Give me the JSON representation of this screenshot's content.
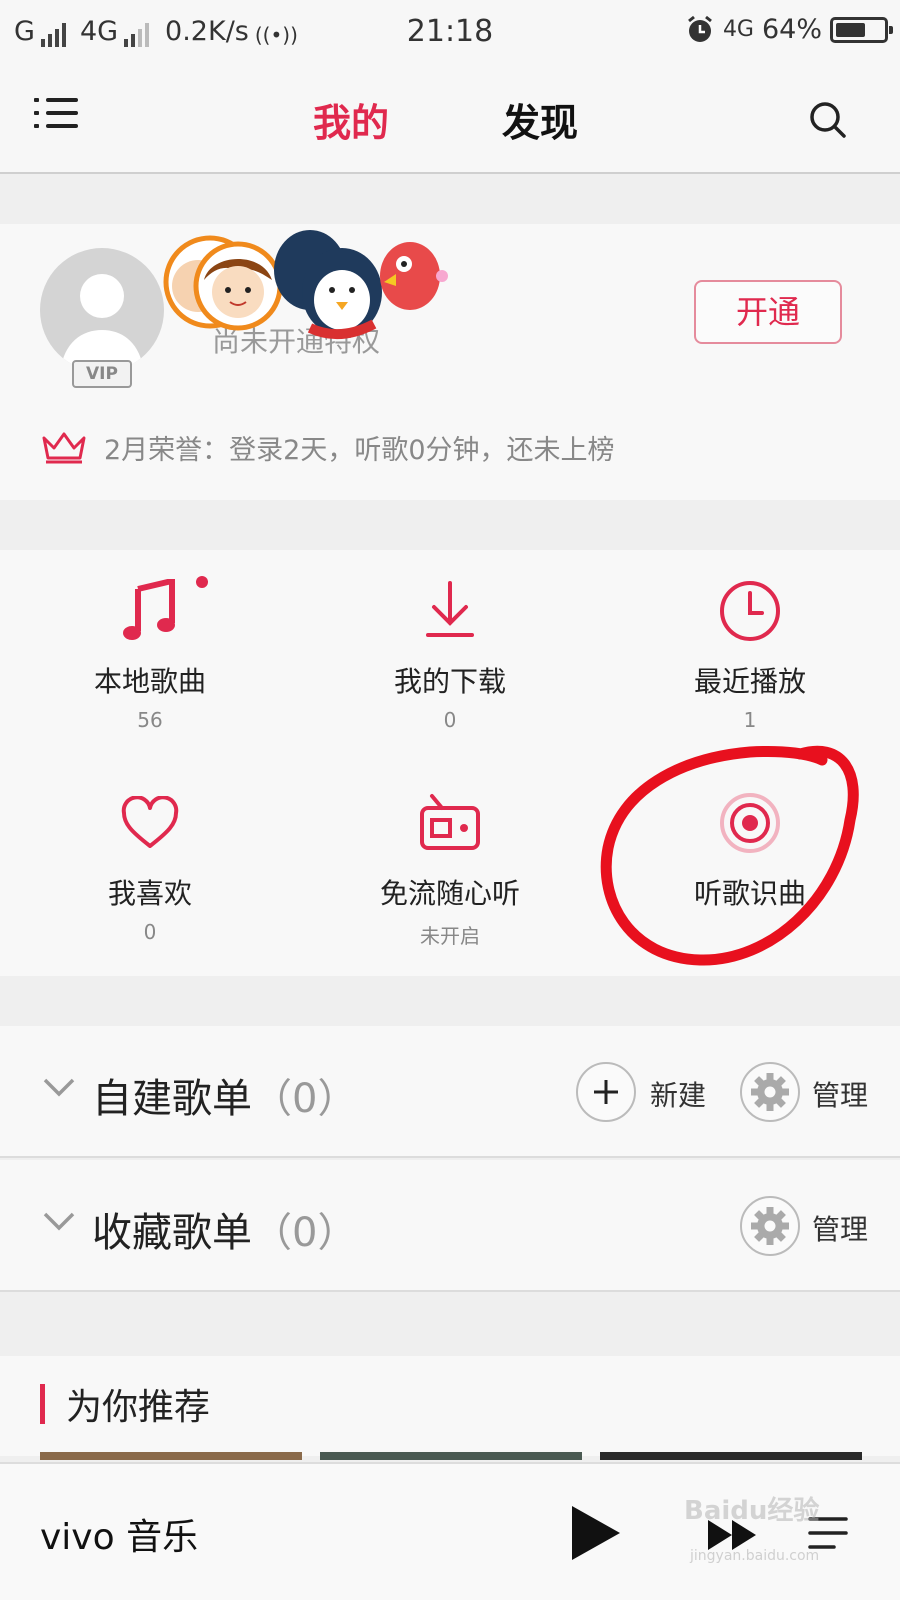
{
  "status_bar": {
    "carrier": "G",
    "network": "4G",
    "speed": "0.2K/s",
    "time": "21:18",
    "network2": "4G",
    "battery": "64%",
    "battery_level": 0.64
  },
  "nav": {
    "tabs": [
      {
        "label": "我的",
        "active": true
      },
      {
        "label": "发现",
        "active": false
      }
    ]
  },
  "profile": {
    "vip_badge": "VIP",
    "privilege_text": "尚未开通特权",
    "open_button": "开通",
    "honor_text": "2月荣誉：登录2天，听歌0分钟，还未上榜"
  },
  "grid": {
    "items": [
      {
        "label": "本地歌曲",
        "sub": "56",
        "icon": "music-note-icon"
      },
      {
        "label": "我的下载",
        "sub": "0",
        "icon": "download-icon"
      },
      {
        "label": "最近播放",
        "sub": "1",
        "icon": "clock-icon"
      },
      {
        "label": "我喜欢",
        "sub": "0",
        "icon": "heart-icon"
      },
      {
        "label": "免流随心听",
        "sub": "未开启",
        "icon": "radio-icon"
      },
      {
        "label": "听歌识曲",
        "sub": "",
        "icon": "recognize-icon"
      }
    ]
  },
  "playlists": {
    "created": {
      "title": "自建歌单",
      "count": "（0）",
      "new_label": "新建",
      "manage_label": "管理"
    },
    "collected": {
      "title": "收藏歌单",
      "count": "（0）",
      "manage_label": "管理"
    }
  },
  "recommend": {
    "title": "为你推荐"
  },
  "player": {
    "app_name": "vivo 音乐"
  },
  "watermark": {
    "text": "Baidu经验",
    "url": "jingyan.baidu.com"
  },
  "colors": {
    "accent": "#e0294e",
    "annotation": "#e8101e"
  }
}
